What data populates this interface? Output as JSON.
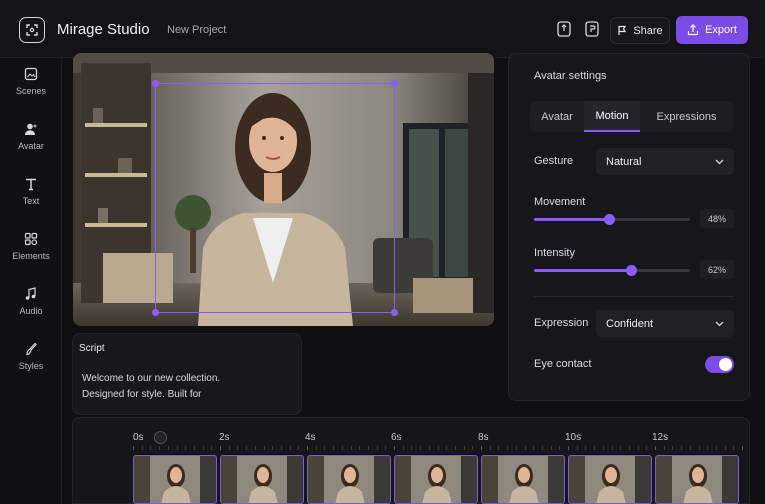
{
  "header": {
    "app_title": "Mirage Studio",
    "project_name": "New Project",
    "share_label": "Share",
    "export_label": "Export",
    "icons": [
      "logo-icon",
      "undo-icon",
      "redo-icon",
      "share-icon",
      "export-icon"
    ]
  },
  "sidebar": {
    "items": [
      {
        "label": "Scenes",
        "icon": "scenes-icon"
      },
      {
        "label": "Avatar",
        "icon": "avatar-icon"
      },
      {
        "label": "Text",
        "icon": "text-icon"
      },
      {
        "label": "Elements",
        "icon": "elements-icon"
      },
      {
        "label": "Audio",
        "icon": "audio-icon"
      },
      {
        "label": "Styles",
        "icon": "styles-icon"
      }
    ]
  },
  "script": {
    "title": "Script",
    "text_line1": "Welcome to our new collection.",
    "text_line2": "Designed for style. Built for"
  },
  "settings": {
    "title": "Avatar settings",
    "tabs": [
      "Avatar",
      "Motion",
      "Expressions"
    ],
    "active_tab": "Motion",
    "gesture": {
      "label": "Gesture",
      "value": "Natural"
    },
    "movement": {
      "label": "Movement",
      "value": 48,
      "display": "48%"
    },
    "intensity": {
      "label": "Intensity",
      "value": 62,
      "display": "62%"
    },
    "expression": {
      "label": "Expression",
      "value": "Confident"
    },
    "eye_contact": {
      "label": "Eye contact",
      "on": true
    }
  },
  "timeline": {
    "ticks": [
      "0s",
      "2s",
      "4s",
      "6s",
      "8s",
      "10s",
      "12s"
    ],
    "clip_count": 7
  },
  "colors": {
    "accent": "#7c4ce6",
    "background": "#0f0f12",
    "panel": "#16161b"
  }
}
